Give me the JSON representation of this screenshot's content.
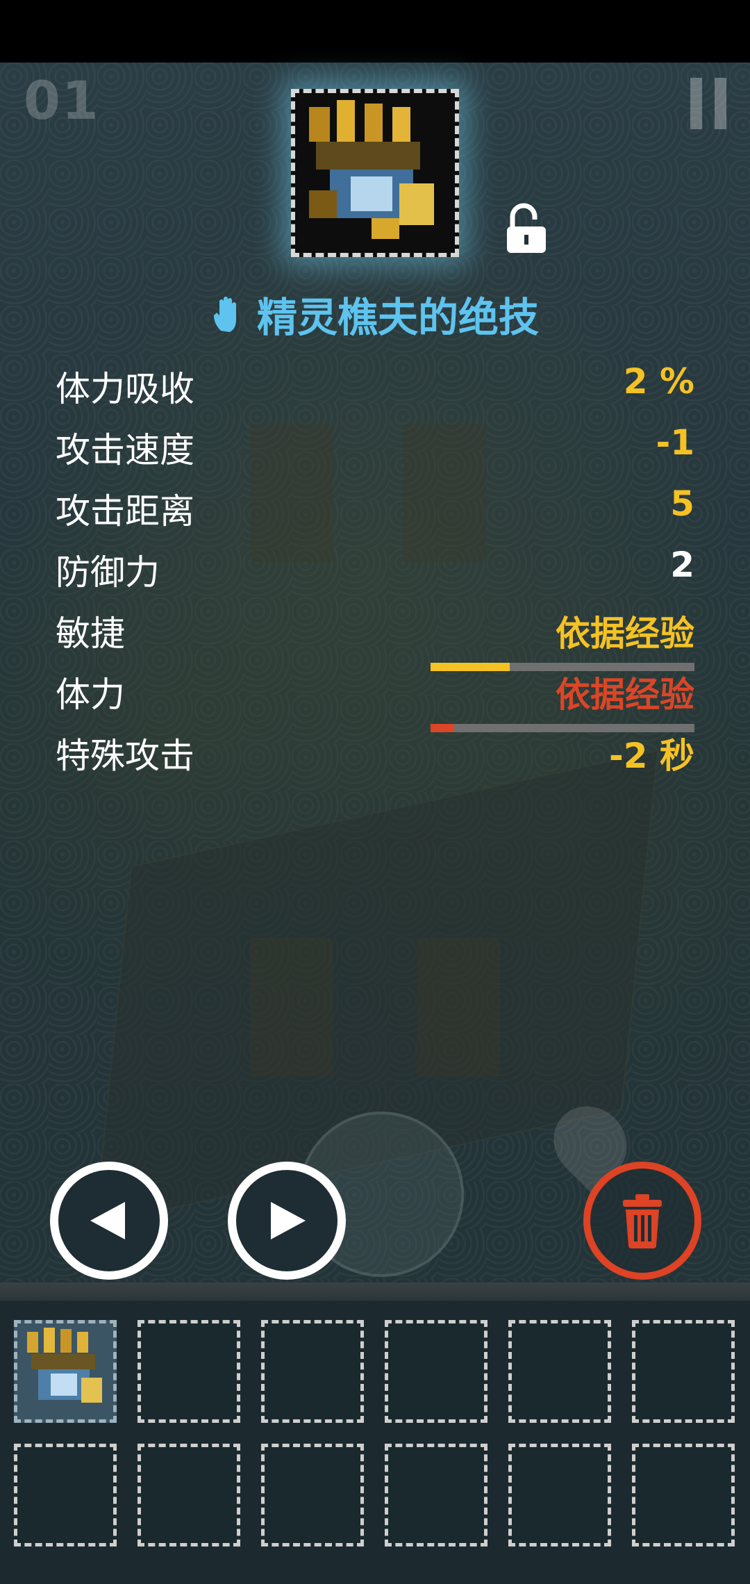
{
  "hud": {
    "level": "01"
  },
  "item": {
    "name": "精灵樵夫的绝技",
    "lock_state": "unlocked"
  },
  "stats": [
    {
      "label": "体力吸收",
      "value": "2 %",
      "color": "#f5c224"
    },
    {
      "label": "攻击速度",
      "value": "-1",
      "color": "#f5c224"
    },
    {
      "label": "攻击距离",
      "value": "5",
      "color": "#f5c224"
    },
    {
      "label": "防御力",
      "value": "2",
      "color": "#ffffff"
    },
    {
      "label": "敏捷",
      "value": "依据经验",
      "color": "#f5c224",
      "progress": 0.3,
      "bar_color": "#f5c224"
    },
    {
      "label": "体力",
      "value": "依据经验",
      "color": "#db4626",
      "progress": 0.09,
      "bar_color": "#db4626"
    },
    {
      "label": "特殊攻击",
      "value": "-2 秒",
      "color": "#f5c224"
    }
  ],
  "controls": {
    "prev_icon": "triangle-left-icon",
    "next_icon": "triangle-right-icon",
    "delete_icon": "trash-icon",
    "delete_color": "#dd4324"
  },
  "inventory": {
    "slots_total": 12,
    "filled_slots": [
      0
    ]
  }
}
